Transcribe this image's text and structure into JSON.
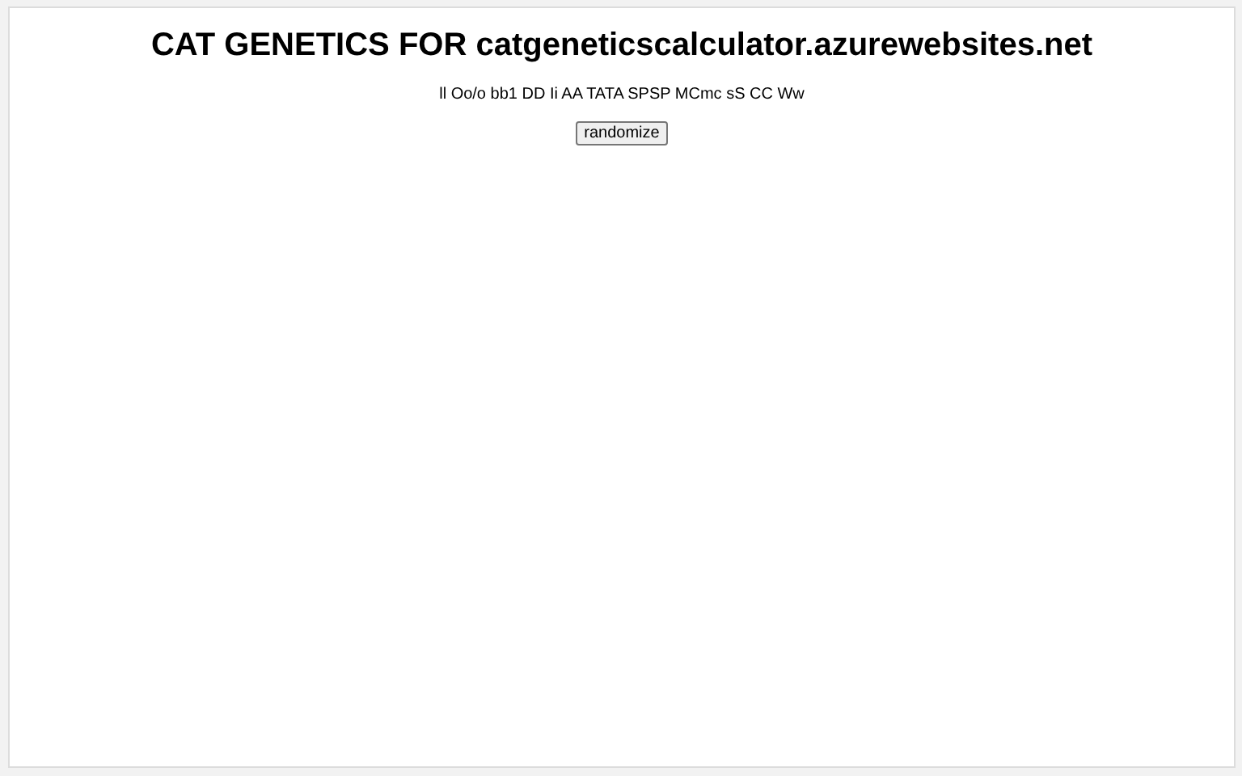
{
  "title": "CAT GENETICS FOR catgeneticscalculator.azurewebsites.net",
  "genotype": "ll Oo/o bb1 DD Ii AA TATA SPSP MCmc sS CC Ww",
  "buttons": [
    "randomize"
  ]
}
